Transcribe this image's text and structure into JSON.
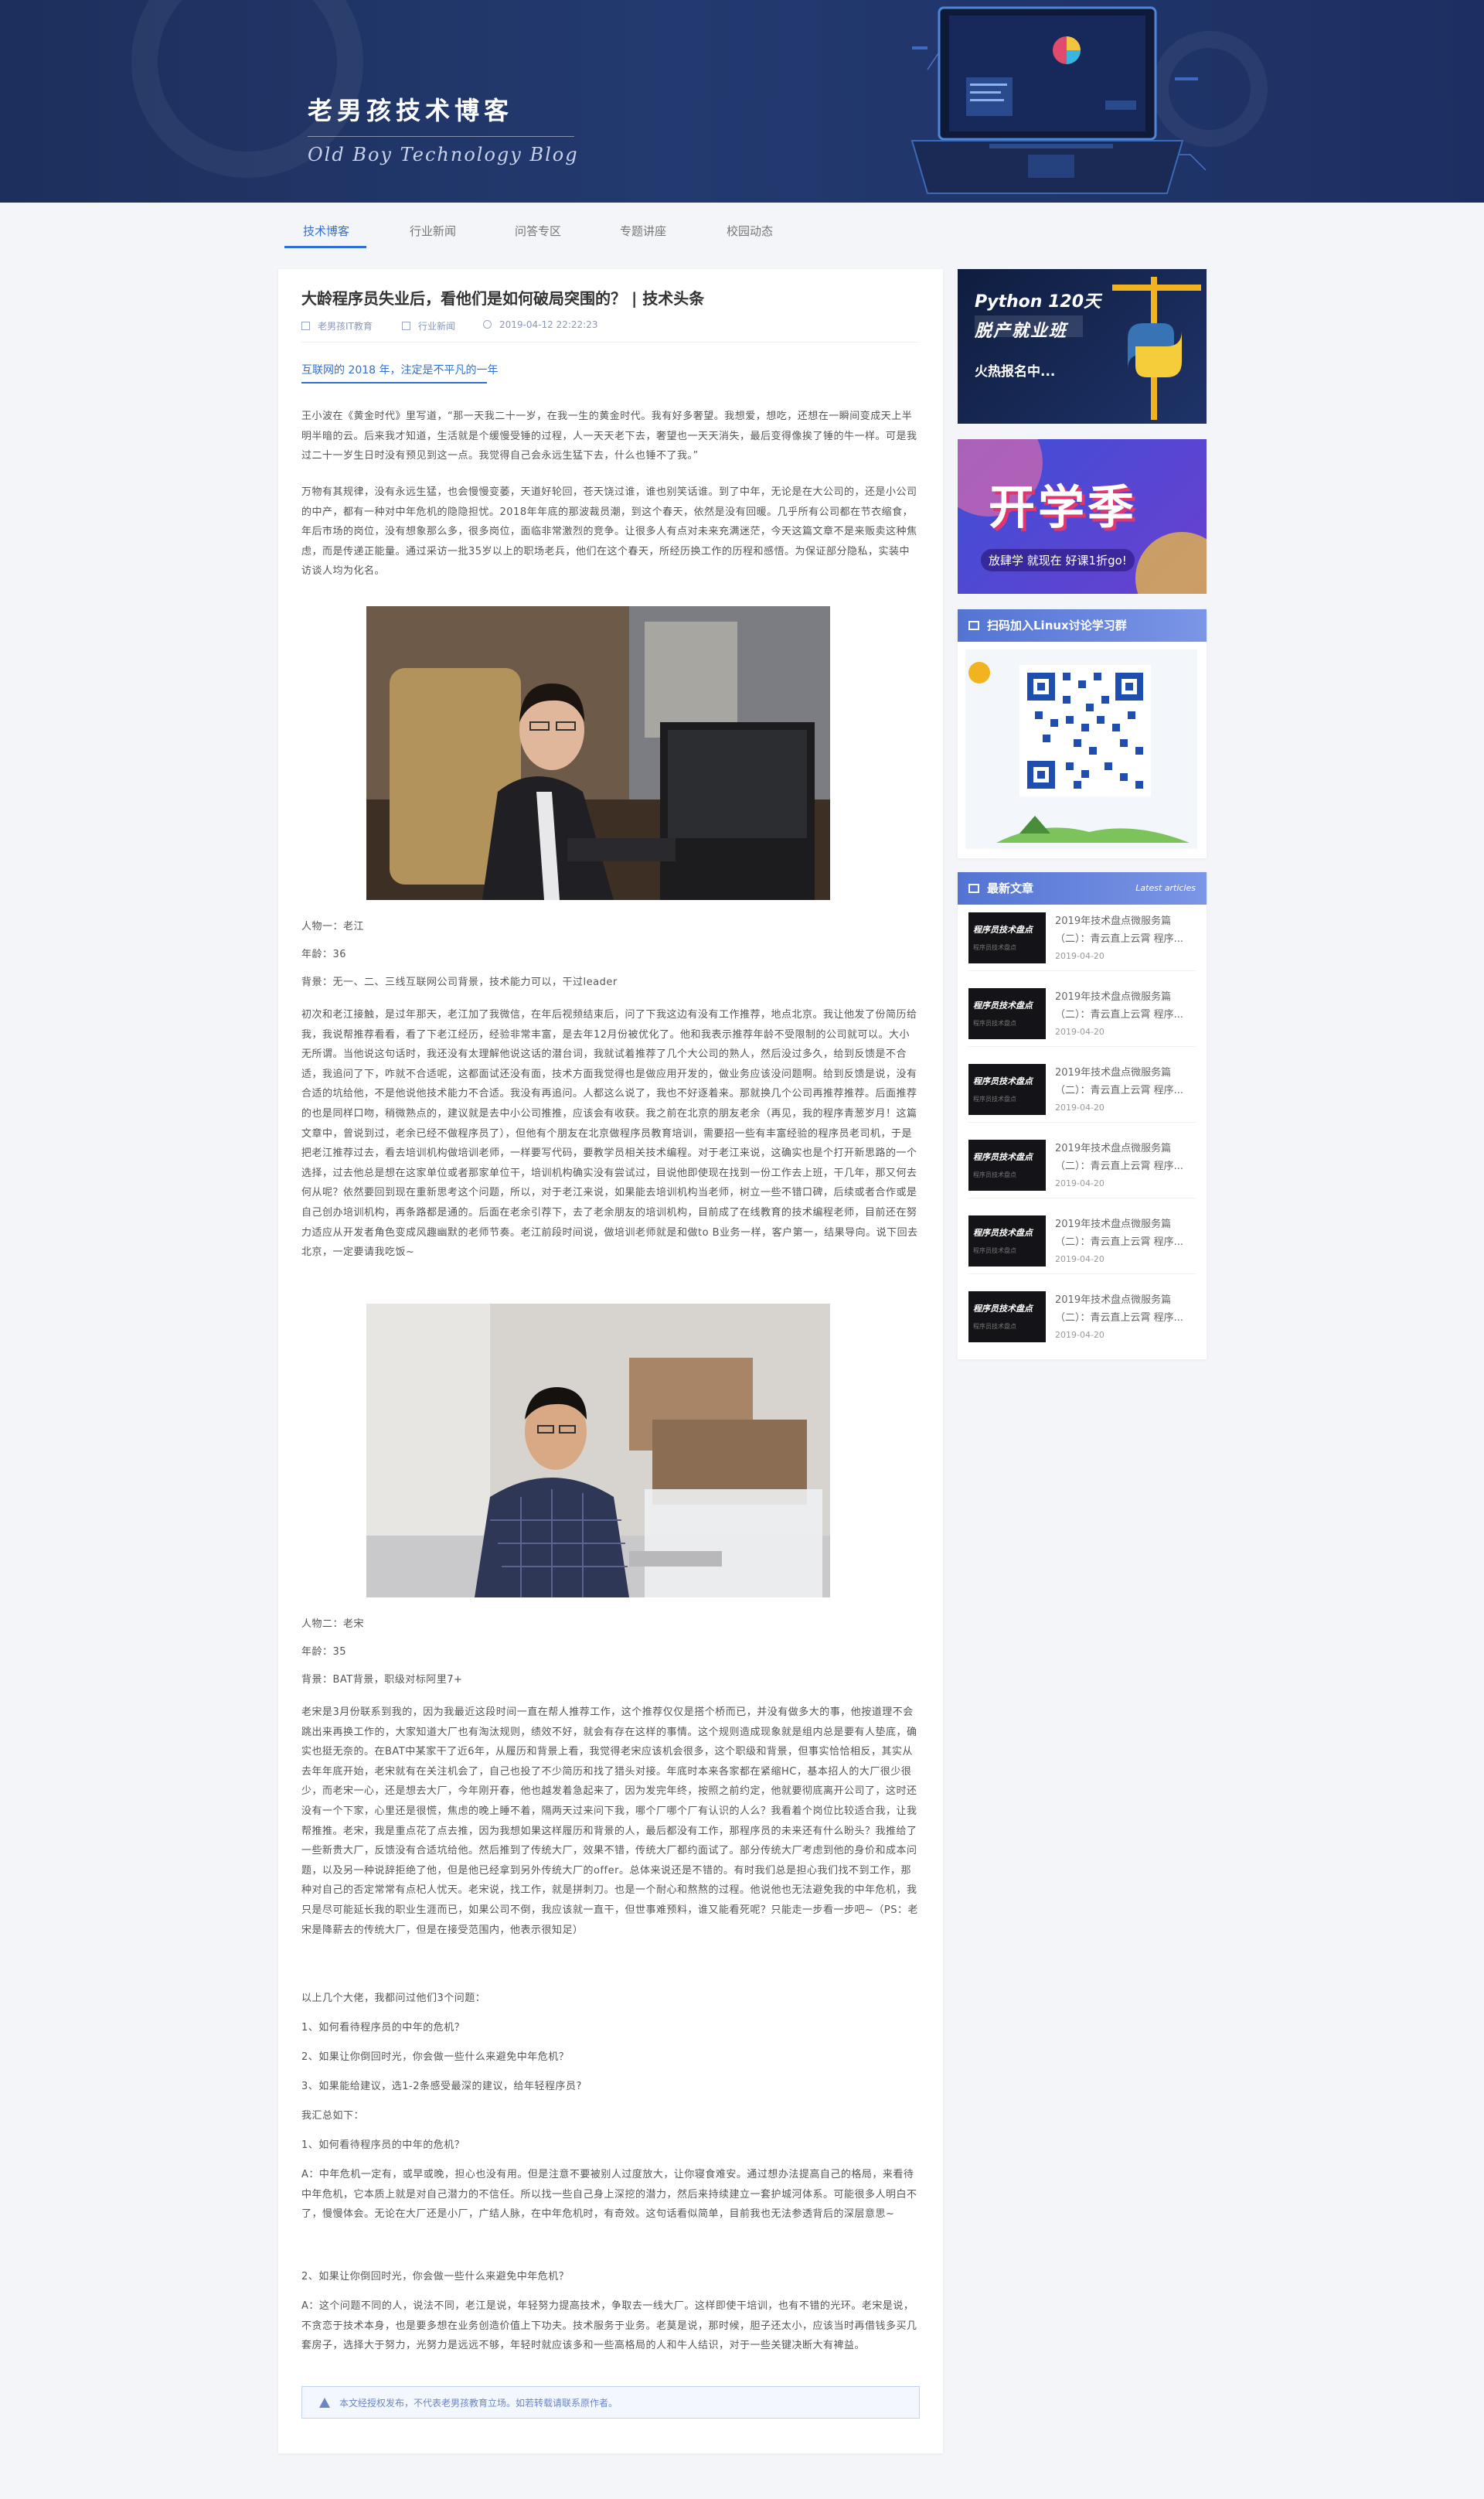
{
  "header": {
    "title": "老男孩技术博客",
    "subtitle": "Old Boy Technology Blog"
  },
  "nav": {
    "items": [
      "技术博客",
      "行业新闻",
      "问答专区",
      "专题讲座",
      "校园动态"
    ]
  },
  "article": {
    "title": "大龄程序员失业后，看他们是如何破局突围的？ | 技术头条",
    "author": "老男孩IT教育",
    "category": "行业新闻",
    "date": "2019-04-12  22:22:23",
    "subtitle": "互联网的 2018 年，注定是不平凡的一年",
    "intro1": "王小波在《黄金时代》里写道，“那一天我二十一岁，在我一生的黄金时代。我有好多奢望。我想爱，想吃，还想在一瞬间变成天上半明半暗的云。后来我才知道，生活就是个缓慢受锤的过程，人一天天老下去，奢望也一天天消失，最后变得像挨了锤的牛一样。可是我过二十一岁生日时没有预见到这一点。我觉得自己会永远生猛下去，什么也锤不了我。”",
    "intro2": "万物有其规律，没有永远生猛，也会慢慢变萎，天道好轮回，苍天饶过谁，谁也别笑话谁。到了中年，无论是在大公司的，还是小公司的中产，都有一种对中年危机的隐隐担忧。2018年年底的那波裁员潮，到这个春天，依然是没有回暖。几乎所有公司都在节衣缩食，年后市场的岗位，没有想象那么多，很多岗位，面临非常激烈的竞争。让很多人有点对未来充满迷茫，今天这篇文章不是来贩卖这种焦虑，而是传递正能量。通过采访一批35岁以上的职场老兵，他们在这个春天，所经历换工作的历程和感悟。为保证部分隐私，实装中访谈人均为化名。",
    "p1_name": "人物一：老江",
    "p1_age": "年龄：36",
    "p1_bg": "背景：无一、二、三线互联网公司背景，技术能力可以，干过leader",
    "p1_story": "初次和老江接触，是过年那天，老江加了我微信，在年后视频结束后，问了下我这边有没有工作推荐，地点北京。我让他发了份简历给我，我说帮推荐看看，看了下老江经历，经验非常丰富，是去年12月份被优化了。他和我表示推荐年龄不受限制的公司就可以。大小无所谓。当他说这句话时，我还没有太理解他说这话的潜台词，我就试着推荐了几个大公司的熟人，然后没过多久，给到反馈是不合适，我追问了下，咋就不合适呢，这都面试还没有面，技术方面我觉得也是做应用开发的，做业务应该没问题啊。给到反馈是说，没有合适的坑给他，不是他说他技术能力不合适。我没有再追问。人都这么说了，我也不好逐着来。那就换几个公司再推荐推荐。后面推荐的也是同样口吻，稍微熟点的，建议就是去中小公司推推，应该会有收获。我之前在北京的朋友老余（再见，我的程序青葱岁月！这篇文章中，曾说到过，老余已经不做程序员了），但他有个朋友在北京做程序员教育培训，需要招一些有丰富经验的程序员老司机，于是把老江推荐过去，看去培训机构做培训老师，一样要写代码，要教学员相关技术编程。对于老江来说，这确实也是个打开新思路的一个选择，过去他总是想在这家单位或者那家单位干，培训机构确实没有尝试过，目说他即使现在找到一份工作去上班，干几年，那又何去何从呢？依然要回到现在重新思考这个问题，所以，对于老江来说，如果能去培训机构当老师，树立一些不错口碑，后续或者合作或是自己创办培训机构，再条路都是通的。后面在老余引荐下，去了老余朋友的培训机构，目前成了在线教育的技术编程老师，目前还在努力适应从开发者角色变成风趣幽默的老师节奏。老江前段时间说，做培训老师就是和做to B业务一样，客户第一，结果导向。说下回去北京，一定要请我吃饭~",
    "p2_name": "人物二：老宋",
    "p2_age": "年龄：35",
    "p2_bg": "背景：BAT背景，职级对标阿里7+",
    "p2_story": "老宋是3月份联系到我的，因为我最近这段时间一直在帮人推荐工作，这个推荐仅仅是搭个桥而已，并没有做多大的事，他按道理不会跳出来再换工作的，大家知道大厂也有淘汰规则，绩效不好，就会有存在这样的事情。这个规则造成现象就是组内总是要有人垫底，确实也挺无奈的。在BAT中某家干了近6年，从履历和背景上看，我觉得老宋应该机会很多，这个职级和背景，但事实恰恰相反，其实从去年年底开始，老宋就有在关注机会了，自己也投了不少简历和找了猎头对接。年底时本来各家都在紧缩HC，基本招人的大厂很少很少，而老宋一心，还是想去大厂，今年刚开春，他也越发着急起来了，因为发完年终，按照之前约定，他就要彻底离开公司了，这时还没有一个下家，心里还是很慌，焦虑的晚上睡不着，隔两天过来问下我，哪个厂哪个厂有认识的人么？我看着个岗位比较适合我，让我帮推推。老宋，我是重点花了点去推，因为我想如果这样履历和背景的人，最后都没有工作，那程序员的未来还有什么盼头？我推给了一些新贵大厂，反馈没有合适坑给他。然后推到了传统大厂，效果不错，传统大厂都约面试了。部分传统大厂考虑到他的身价和成本问题，以及另一种说辞拒绝了他，但是他已经拿到另外传统大厂的offer。总体来说还是不错的。有时我们总是担心我们找不到工作，那种对自己的否定常常有点杞人忧天。老宋说，找工作，就是拼刺刀。也是一个耐心和熬熬的过程。他说他也无法避免我的中年危机，我只是尽可能延长我的职业生涯而已，如果公司不倒，我应该就一直干，但世事难预料，谁又能看死呢？只能走一步看一步吧~（PS：老宋是降薪去的传统大厂，但是在接受范围内，他表示很知足）",
    "q_intro": "以上几个大佬，我都问过他们3个问题：",
    "q1": "1、如何看待程序员的中年的危机？",
    "q2": "2、如果让你倒回时光，你会做一些什么来避免中年危机？",
    "q3": "3、如果能给建议，选1-2条感受最深的建议，给年轻程序员?",
    "summary": "我汇总如下：",
    "s_q1": "1、如何看待程序员的中年的危机？",
    "a1": "A：中年危机一定有，或早或晚，担心也没有用。但是注意不要被别人过度放大，让你寝食难安。通过想办法提高自己的格局，来看待中年危机，它本质上就是对自己潜力的不信任。所以找一些自己身上深挖的潜力，然后来持续建立一套护城河体系。可能很多人明白不了，慢慢体会。无论在大厂还是小厂，广结人脉，在中年危机时，有奇效。这句话看似简单，目前我也无法参透背后的深层意思~",
    "s_q2": "2、如果让你倒回时光，你会做一些什么来避免中年危机？",
    "a2": "A：这个问题不同的人，说法不同，老江是说，年轻努力提高技术，争取去一线大厂。这样即使干培训，也有不错的光环。老宋是说，不贪恋于技术本身，也是要多想在业务创造价值上下功夫。技术服务于业务。老莫是说，那时候，胆子还太小，应该当时再借钱多买几套房子，选择大于努力，光努力是远远不够，年轻时就应该多和一些高格局的人和牛人结识，对于一些关键决断大有裨益。",
    "notice": "本文经授权发布，不代表老男孩教育立场。如若转载请联系原作者。"
  },
  "sidebar": {
    "ad1": {
      "line1": "Python 120天",
      "line2": "脱产就业班",
      "line3": "火热报名中..."
    },
    "ad2": {
      "big": "开学季",
      "small": "放肆学 就现在 好课1折go!"
    },
    "qr_title": "扫码加入Linux讨论学习群",
    "latest_title": "最新文章",
    "latest_sub": "Latest articles",
    "latest_items": [
      {
        "title": "2019年技术盘点微服务篇（二）：青云直上云霄 程序...",
        "date": "2019-04-20"
      },
      {
        "title": "2019年技术盘点微服务篇（二）：青云直上云霄 程序...",
        "date": "2019-04-20"
      },
      {
        "title": "2019年技术盘点微服务篇（二）：青云直上云霄 程序...",
        "date": "2019-04-20"
      },
      {
        "title": "2019年技术盘点微服务篇（二）：青云直上云霄 程序...",
        "date": "2019-04-20"
      },
      {
        "title": "2019年技术盘点微服务篇（二）：青云直上云霄 程序...",
        "date": "2019-04-20"
      },
      {
        "title": "2019年技术盘点微服务篇（二）：青云直上云霄 程序...",
        "date": "2019-04-20"
      }
    ],
    "thumb_text": "程序员技术盘点"
  }
}
